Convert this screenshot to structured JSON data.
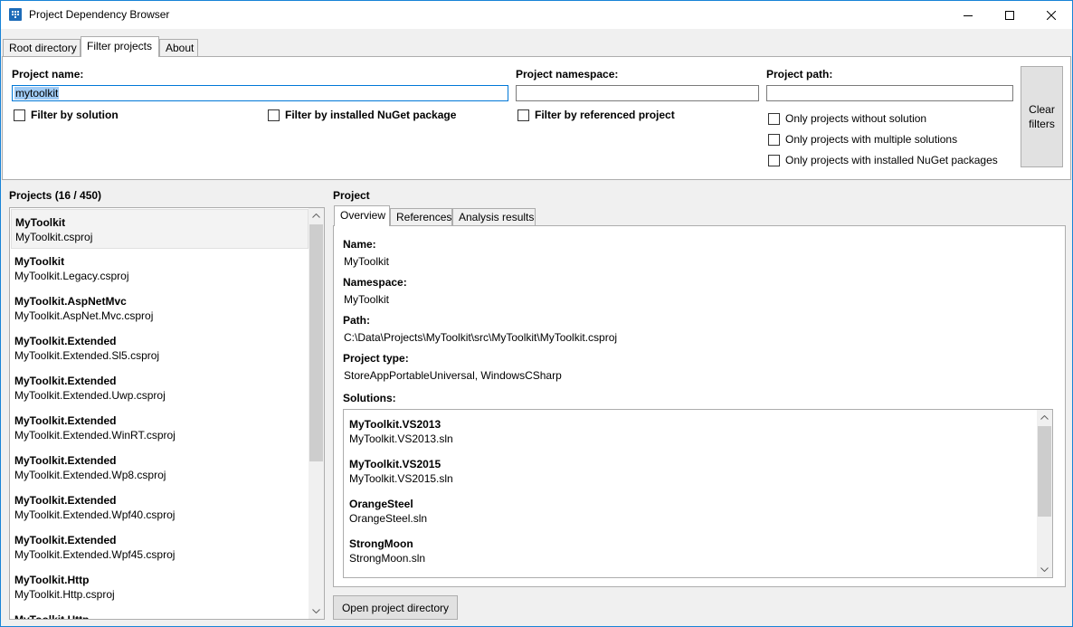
{
  "window": {
    "title": "Project Dependency Browser"
  },
  "main_tabs": [
    {
      "label": "Root directory"
    },
    {
      "label": "Filter projects"
    },
    {
      "label": "About"
    }
  ],
  "filters": {
    "project_name_label": "Project name:",
    "project_name_value": "mytoolkit",
    "project_namespace_label": "Project namespace:",
    "project_namespace_value": "",
    "project_path_label": "Project path:",
    "project_path_value": "",
    "filter_by_solution": "Filter by solution",
    "filter_by_nuget": "Filter by installed NuGet package",
    "filter_by_referenced": "Filter by referenced project",
    "only_without_solution": "Only projects without solution",
    "only_multiple_solutions": "Only projects with multiple solutions",
    "only_nuget_packages": "Only projects with installed NuGet packages",
    "clear_filters": "Clear filters"
  },
  "projects": {
    "header": "Projects (16 / 450)",
    "items": [
      {
        "name": "MyToolkit",
        "file": "MyToolkit.csproj"
      },
      {
        "name": "MyToolkit",
        "file": "MyToolkit.Legacy.csproj"
      },
      {
        "name": "MyToolkit.AspNetMvc",
        "file": "MyToolkit.AspNet.Mvc.csproj"
      },
      {
        "name": "MyToolkit.Extended",
        "file": "MyToolkit.Extended.Sl5.csproj"
      },
      {
        "name": "MyToolkit.Extended",
        "file": "MyToolkit.Extended.Uwp.csproj"
      },
      {
        "name": "MyToolkit.Extended",
        "file": "MyToolkit.Extended.WinRT.csproj"
      },
      {
        "name": "MyToolkit.Extended",
        "file": "MyToolkit.Extended.Wp8.csproj"
      },
      {
        "name": "MyToolkit.Extended",
        "file": "MyToolkit.Extended.Wpf40.csproj"
      },
      {
        "name": "MyToolkit.Extended",
        "file": "MyToolkit.Extended.Wpf45.csproj"
      },
      {
        "name": "MyToolkit.Http",
        "file": "MyToolkit.Http.csproj"
      },
      {
        "name": "MyToolkit.Http",
        "file": ""
      }
    ]
  },
  "project": {
    "header": "Project",
    "tabs": [
      {
        "label": "Overview"
      },
      {
        "label": "References"
      },
      {
        "label": "Analysis results"
      }
    ],
    "name_label": "Name:",
    "name_value": "MyToolkit",
    "namespace_label": "Namespace:",
    "namespace_value": "MyToolkit",
    "path_label": "Path:",
    "path_value": "C:\\Data\\Projects\\MyToolkit\\src\\MyToolkit\\MyToolkit.csproj",
    "type_label": "Project type:",
    "type_value": "StoreAppPortableUniversal, WindowsCSharp",
    "solutions_label": "Solutions:",
    "solutions": [
      {
        "name": "MyToolkit.VS2013",
        "file": "MyToolkit.VS2013.sln"
      },
      {
        "name": "MyToolkit.VS2015",
        "file": "MyToolkit.VS2015.sln"
      },
      {
        "name": "OrangeSteel",
        "file": "OrangeSteel.sln"
      },
      {
        "name": "StrongMoon",
        "file": "StrongMoon.sln"
      }
    ],
    "open_directory": "Open project directory"
  }
}
